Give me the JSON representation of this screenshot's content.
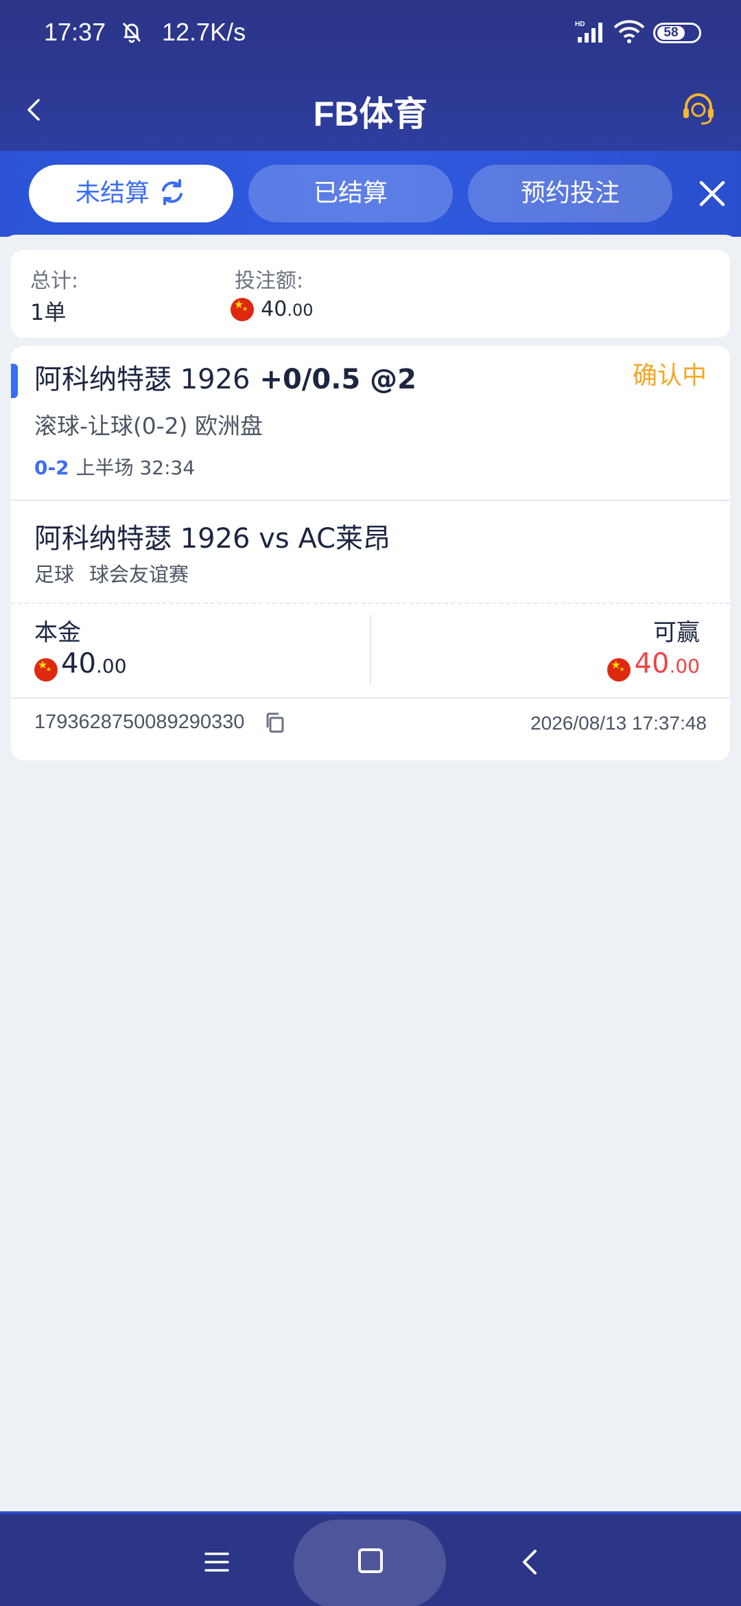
{
  "status_bar": {
    "time": "17:37",
    "speed": "12.7K/s",
    "battery": "58"
  },
  "header": {
    "title": "FB体育"
  },
  "tabs": [
    {
      "label": "未结算",
      "active": true
    },
    {
      "label": "已结算",
      "active": false
    },
    {
      "label": "预约投注",
      "active": false
    }
  ],
  "summary": {
    "total_label": "总计:",
    "total_value": "1单",
    "stake_label": "投注额:",
    "stake_int": "40",
    "stake_dec": ".00"
  },
  "bet": {
    "selection_team": "阿科纳特瑟 1926",
    "selection_odds": " +0/0.5 @2",
    "status": "确认中",
    "market": "滚球-让球(0-2) 欧洲盘",
    "score": "0-2",
    "period": "上半场 32:34",
    "match": "阿科纳特瑟 1926 vs AC莱昂",
    "sport": "足球",
    "league": "球会友谊赛",
    "stake_label": "本金",
    "stake_int": "40",
    "stake_dec": ".00",
    "win_label": "可赢",
    "win_int": "40",
    "win_dec": ".00",
    "order_id": "1793628750089290330",
    "order_time": "2026/08/13 17:37:48"
  },
  "colors": {
    "accent": "#3b6cf5",
    "pending": "#f5a623",
    "win": "#ef4444",
    "header_bg": "#2b3486"
  }
}
